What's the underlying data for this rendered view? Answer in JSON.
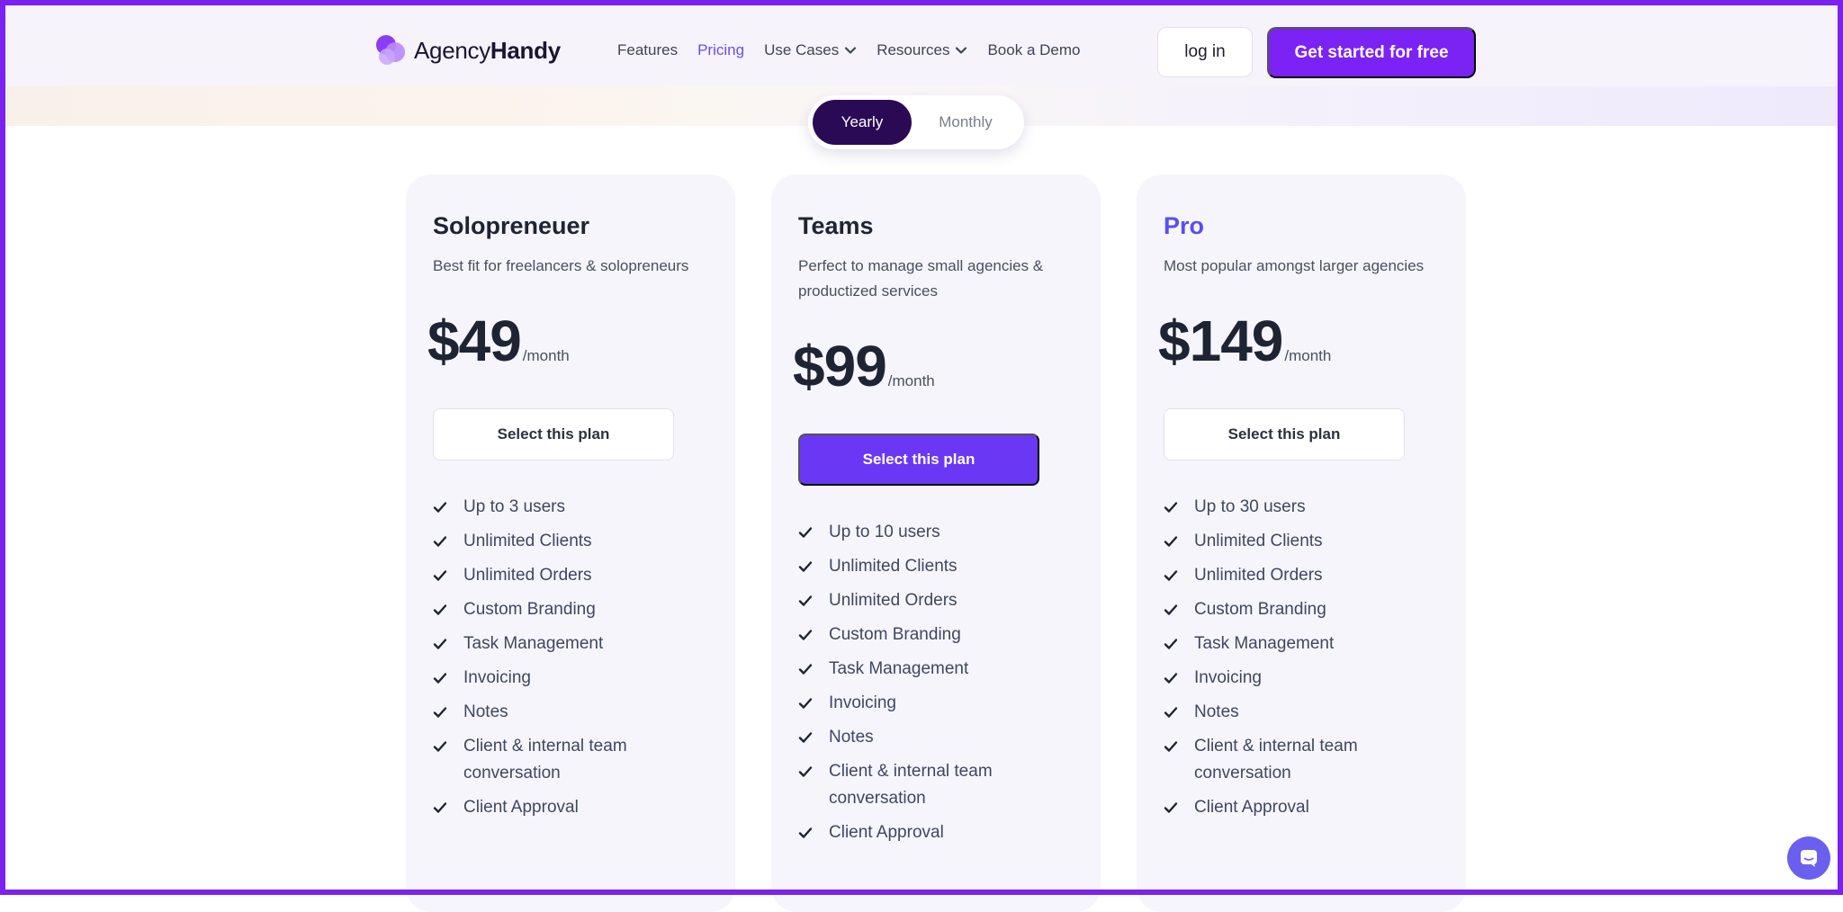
{
  "brand": {
    "name_regular": "Agency",
    "name_bold": "Handy"
  },
  "nav": {
    "items": [
      {
        "label": "Features",
        "active": false,
        "dropdown": false
      },
      {
        "label": "Pricing",
        "active": true,
        "dropdown": false
      },
      {
        "label": "Use Cases",
        "active": false,
        "dropdown": true
      },
      {
        "label": "Resources",
        "active": false,
        "dropdown": true
      },
      {
        "label": "Book a Demo",
        "active": false,
        "dropdown": false
      }
    ],
    "login_label": "log in",
    "cta_label": "Get started for free"
  },
  "billing_toggle": {
    "yearly": "Yearly",
    "monthly": "Monthly",
    "selected": "Yearly"
  },
  "plans": [
    {
      "title": "Solopreneuer",
      "description": "Best fit for freelancers & solopreneurs",
      "price": "$49",
      "unit": "/month",
      "button": "Select this plan",
      "features": [
        "Up to 3 users",
        "Unlimited Clients",
        "Unlimited Orders",
        "Custom Branding",
        "Task Management",
        "Invoicing",
        "Notes",
        "Client & internal team conversation",
        "Client Approval"
      ]
    },
    {
      "title": "Teams",
      "description": "Perfect to manage small agencies & productized services",
      "price": "$99",
      "unit": "/month",
      "button": "Select this plan",
      "features": [
        "Up to 10 users",
        "Unlimited Clients",
        "Unlimited Orders",
        "Custom Branding",
        "Task Management",
        "Invoicing",
        "Notes",
        "Client & internal team conversation",
        "Client Approval"
      ]
    },
    {
      "title": "Pro",
      "description": "Most popular amongst larger agencies",
      "price": "$149",
      "unit": "/month",
      "button": "Select this plan",
      "features": [
        "Up to 30 users",
        "Unlimited Clients",
        "Unlimited Orders",
        "Custom Branding",
        "Task Management",
        "Invoicing",
        "Notes",
        "Client & internal team conversation",
        "Client Approval"
      ]
    }
  ],
  "icons": {
    "check": "check-icon",
    "chevron": "chevron-down-icon",
    "chat": "chat-icon",
    "logo": "agencyhandy-logo-icon"
  },
  "colors": {
    "accent": "#7b22f5",
    "primary_button": "#6a38f5",
    "toggle_active": "#2a0a55",
    "pro_title": "#5a4ef0",
    "card_bg": "#f6f5fb",
    "frame": "#7b22f0"
  }
}
